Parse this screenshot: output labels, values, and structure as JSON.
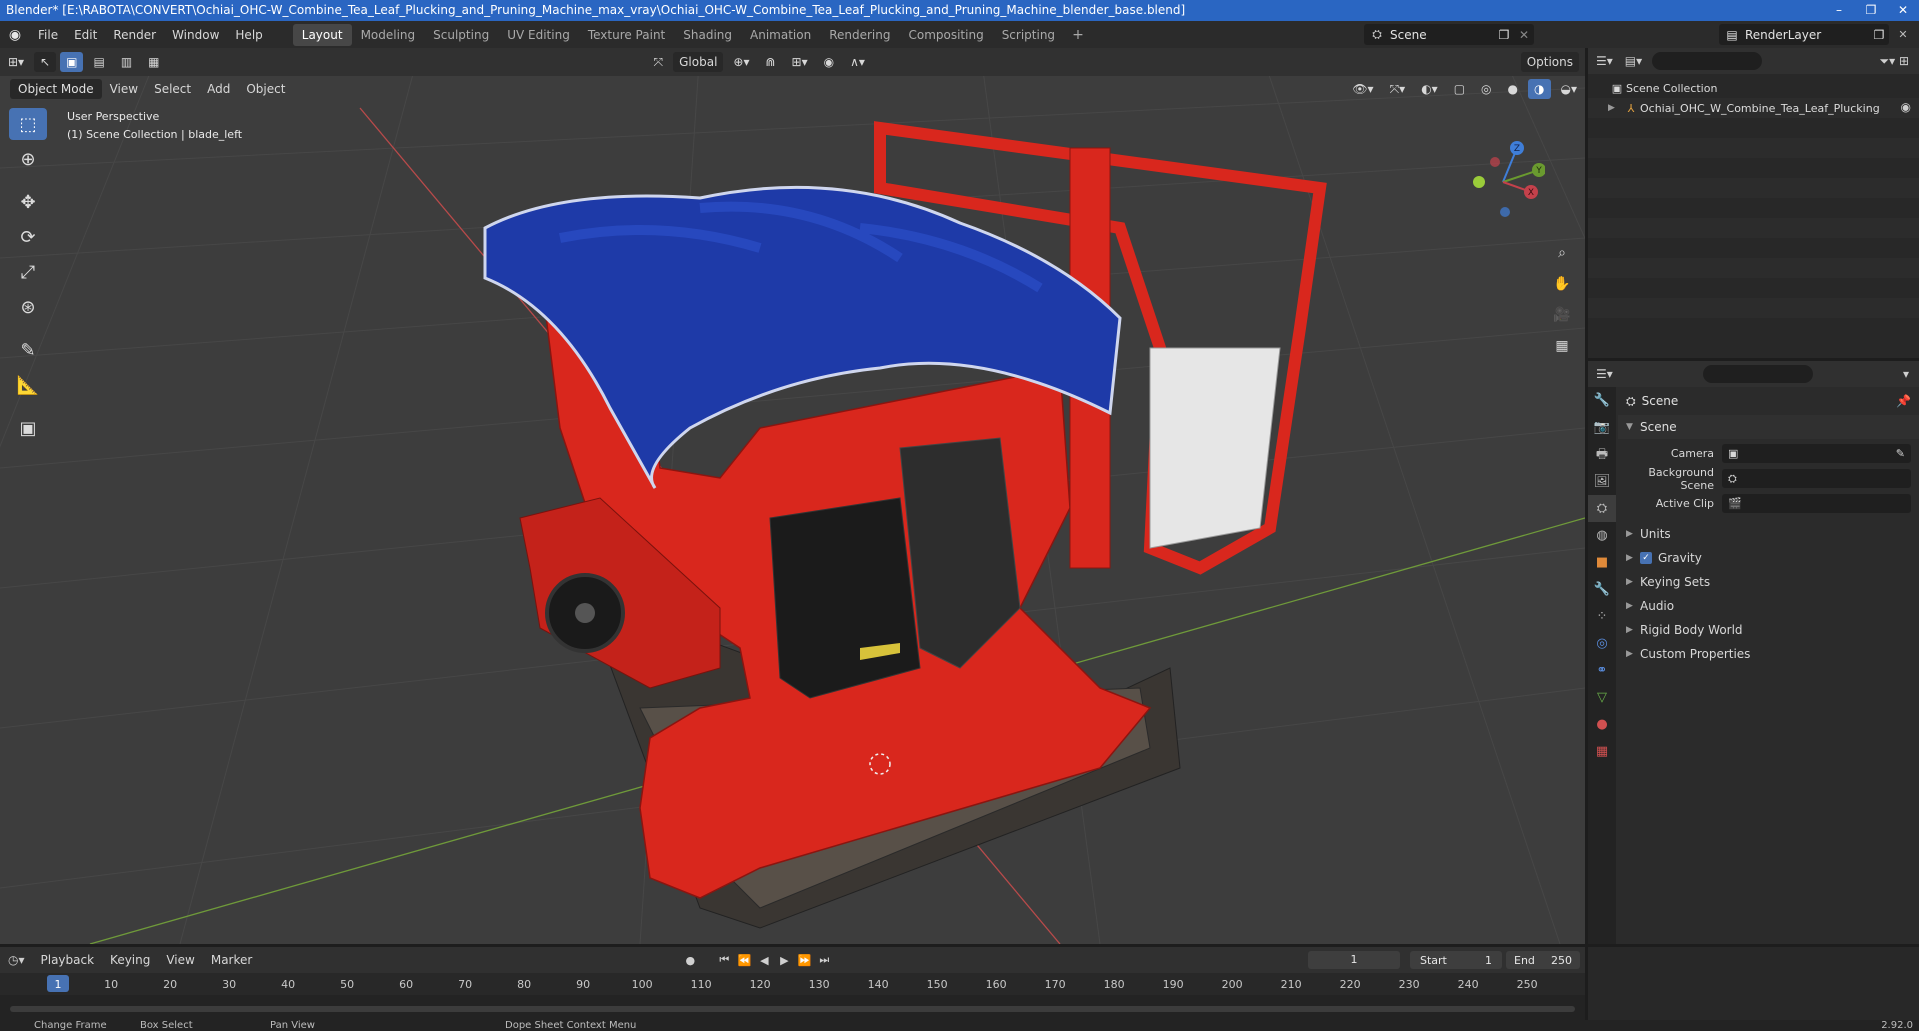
{
  "window": {
    "title": "Blender* [E:\\RABOTA\\CONVERT\\Ochiai_OHC-W_Combine_Tea_Leaf_Plucking_and_Pruning_Machine_max_vray\\Ochiai_OHC-W_Combine_Tea_Leaf_Plucking_and_Pruning_Machine_blender_base.blend]",
    "controls": [
      "–",
      "❐",
      "✕"
    ]
  },
  "menubar": {
    "items": [
      "File",
      "Edit",
      "Render",
      "Window",
      "Help"
    ],
    "workspaces": [
      "Layout",
      "Modeling",
      "Sculpting",
      "UV Editing",
      "Texture Paint",
      "Shading",
      "Animation",
      "Rendering",
      "Compositing",
      "Scripting"
    ],
    "active_workspace": "Layout",
    "add_tab": "+",
    "scene": "Scene",
    "render_layer": "RenderLayer"
  },
  "viewport": {
    "mode": "Object Mode",
    "menus": [
      "View",
      "Select",
      "Add",
      "Object"
    ],
    "transform_orientation": "Global",
    "options_label": "Options",
    "overlay_line1": "User Perspective",
    "overlay_line2": "(1) Scene Collection | blade_left",
    "gizmo_axes": {
      "x": "X",
      "y": "Y",
      "z": "Z"
    },
    "colors": {
      "x_axis": "#c4414b",
      "y_axis": "#6a9a2f",
      "z_axis": "#3f7ed8",
      "machine_red": "#d9271d",
      "canopy_blue": "#1e3aa8"
    }
  },
  "outliner": {
    "search_placeholder": "",
    "root": "Scene Collection",
    "items": [
      "Ochiai_OHC_W_Combine_Tea_Leaf_Plucking"
    ]
  },
  "properties": {
    "context_title": "Scene",
    "panel": "Scene",
    "fields": [
      {
        "label": "Camera",
        "value": ""
      },
      {
        "label": "Background Scene",
        "value": ""
      },
      {
        "label": "Active Clip",
        "value": ""
      }
    ],
    "subpanels": [
      "Units",
      "Gravity",
      "Keying Sets",
      "Audio",
      "Rigid Body World",
      "Custom Properties"
    ],
    "gravity_checked": true
  },
  "timeline": {
    "menus": [
      "Playback",
      "Keying",
      "View",
      "Marker"
    ],
    "current_frame": "1",
    "start_label": "Start",
    "start": "1",
    "end_label": "End",
    "end": "250",
    "ruler_ticks": [
      1,
      10,
      20,
      30,
      40,
      50,
      60,
      70,
      80,
      90,
      100,
      110,
      120,
      130,
      140,
      150,
      160,
      170,
      180,
      190,
      200,
      210,
      220,
      230,
      240,
      250
    ]
  },
  "statusbar": {
    "items": [
      "Change Frame",
      "Box Select",
      "Pan View",
      "Dope Sheet Context Menu"
    ],
    "version": "2.92.0"
  }
}
